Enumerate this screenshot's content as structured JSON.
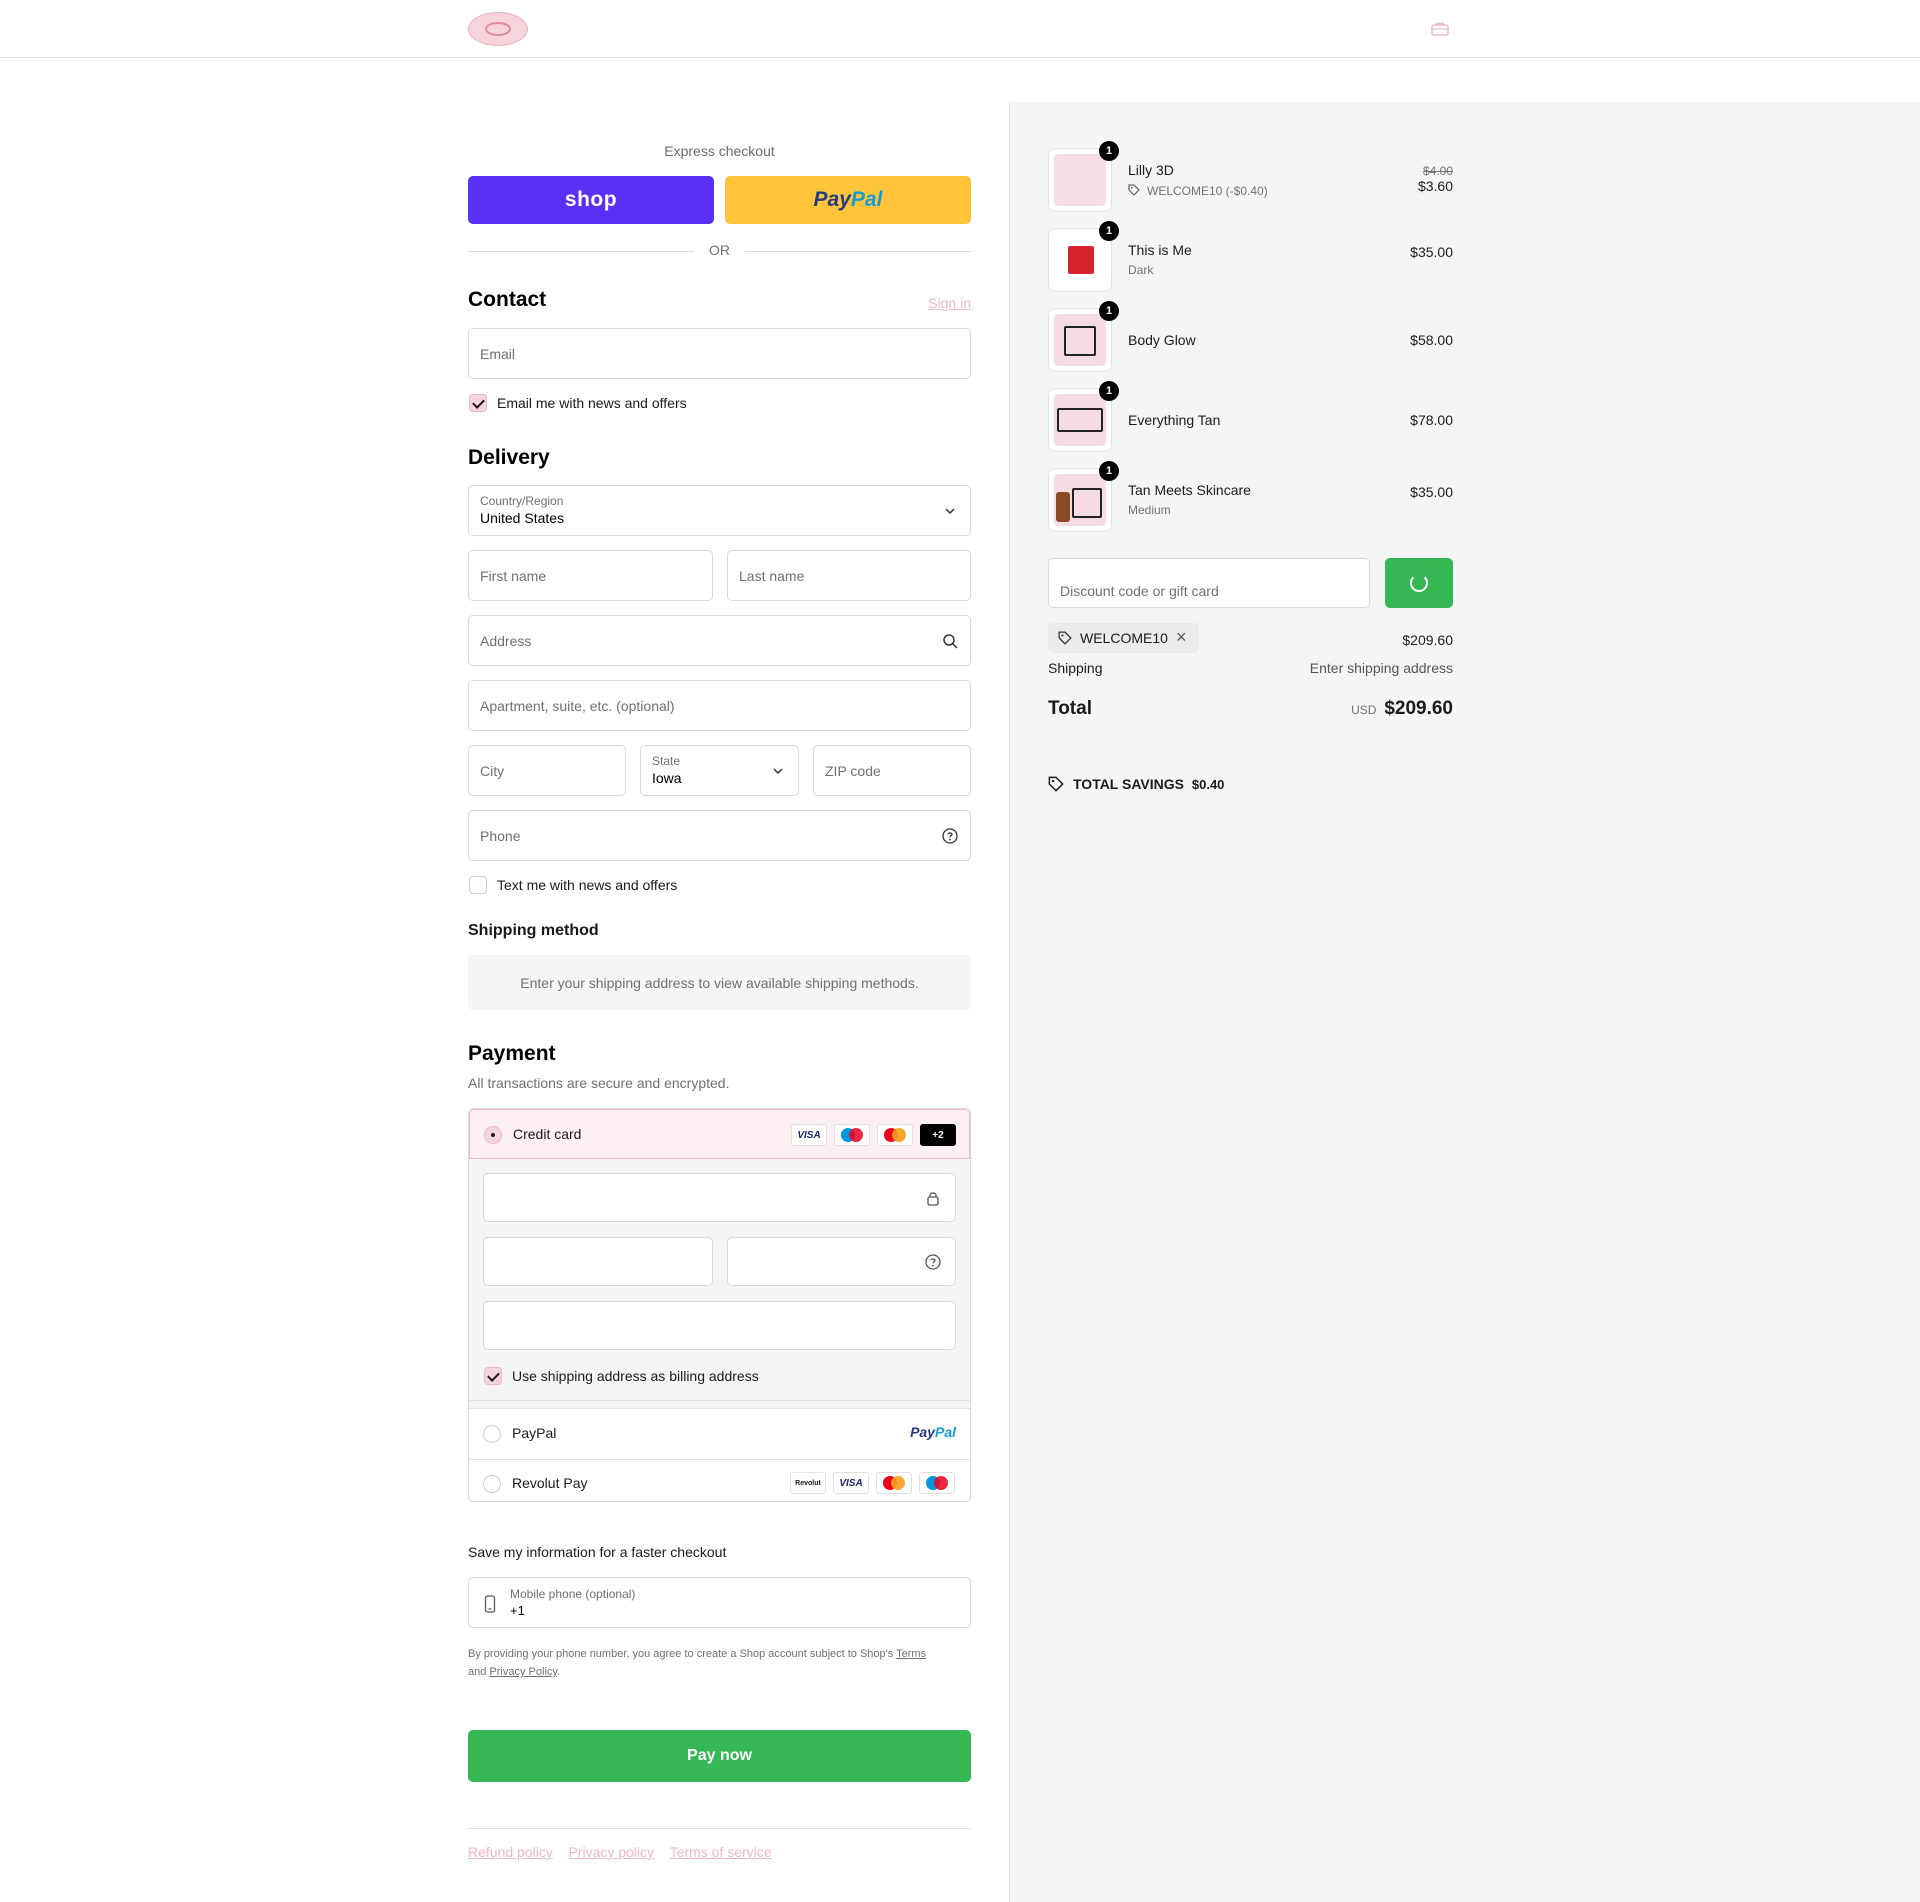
{
  "header": {
    "logo_alt": "store-logo",
    "cart_icon": "bag-icon"
  },
  "express": {
    "label": "Express checkout",
    "shop_label": "shop",
    "paypal_a": "Pay",
    "paypal_b": "Pal",
    "or_label": "OR"
  },
  "contact": {
    "title": "Contact",
    "sign_in": "Sign in",
    "email_placeholder": "Email",
    "newsletter_label": "Email me with news and offers",
    "newsletter_checked": true
  },
  "delivery": {
    "title": "Delivery",
    "country_label": "Country/Region",
    "country_value": "United States",
    "first_name": "First name",
    "last_name": "Last name",
    "address": "Address",
    "apartment": "Apartment, suite, etc. (optional)",
    "city": "City",
    "state_label": "State",
    "state_value": "Iowa",
    "zip": "ZIP code",
    "phone": "Phone",
    "sms_label": "Text me with news and offers",
    "sms_checked": false
  },
  "shipping_method": {
    "title": "Shipping method",
    "notice": "Enter your shipping address to view available shipping methods."
  },
  "payment": {
    "title": "Payment",
    "subtitle": "All transactions are secure and encrypted.",
    "credit_card_label": "Credit card",
    "card_badges": [
      "VISA",
      "maestro",
      "mastercard",
      "+2"
    ],
    "billing_label": "Use shipping address as billing address",
    "billing_checked": true,
    "paypal_label": "PayPal",
    "paypal_logo_a": "Pay",
    "paypal_logo_b": "Pal",
    "revolut_label": "Revolut Pay",
    "revolut_badges": [
      "Revolut",
      "VISA",
      "mastercard",
      "maestro"
    ]
  },
  "save_info": {
    "title": "Save my information for a faster checkout",
    "mobile_label": "Mobile phone (optional)",
    "mobile_value": "+1",
    "legal_prefix": "By providing your phone number, you agree to create a Shop account subject to Shop's",
    "terms": "Terms",
    "and": "and",
    "privacy": "Privacy Policy",
    "period": "."
  },
  "pay_now": "Pay now",
  "footer": {
    "refund": "Refund policy",
    "privacy": "Privacy policy",
    "terms": "Terms of service"
  },
  "summary": {
    "items": [
      {
        "name": "Lilly 3D",
        "sub": "WELCOME10 (-$0.40)",
        "old_price": "$4.00",
        "price": "$3.60",
        "qty": "1"
      },
      {
        "name": "This is Me",
        "sub": "Dark",
        "price": "$35.00",
        "qty": "1"
      },
      {
        "name": "Body Glow",
        "sub": "",
        "price": "$58.00",
        "qty": "1"
      },
      {
        "name": "Everything Tan",
        "sub": "",
        "price": "$78.00",
        "qty": "1"
      },
      {
        "name": "Tan Meets Skincare",
        "sub": "Medium",
        "price": "$35.00",
        "qty": "1"
      }
    ],
    "discount_placeholder": "Discount code or gift card",
    "applied_code": "WELCOME10",
    "subtotal": "$209.60",
    "shipping_label": "Shipping",
    "shipping_value": "Enter shipping address",
    "total_label": "Total",
    "currency": "USD",
    "total_value": "$209.60",
    "savings_label": "TOTAL SAVINGS",
    "savings_value": "$0.40"
  },
  "colors": {
    "shop_purple": "#5a31f4",
    "paypal_yellow": "#ffc439",
    "pay_green": "#35b853",
    "accent_pink": "#f0b8c4"
  }
}
